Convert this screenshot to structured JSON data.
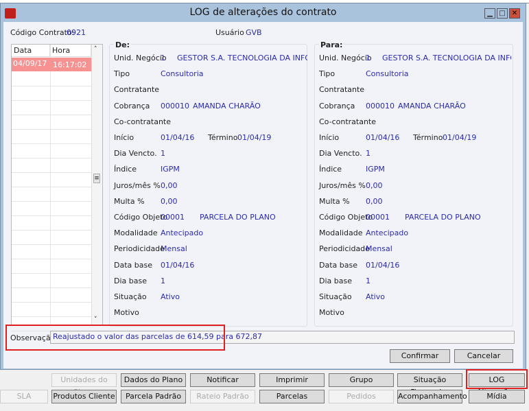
{
  "window": {
    "title": "LOG de alterações do contrato",
    "minimize": "▁",
    "maximize": "□",
    "close": "✕"
  },
  "header": {
    "contract_label": "Código Contrato:",
    "contract_value": "0921",
    "user_label": "Usuário",
    "user_value": "GVB"
  },
  "log_grid": {
    "columns": [
      "Data",
      "Hora"
    ],
    "rows": [
      {
        "data": "04/09/17",
        "hora": "16:17:02"
      }
    ]
  },
  "de": {
    "title": "De:",
    "unid_label": "Unid. Negócio",
    "unid_code": "1",
    "unid_name": "GESTOR S.A. TECNOLOGIA DA INFORMACA",
    "tipo_label": "Tipo",
    "tipo": "Consultoria",
    "contratante_label": "Contratante",
    "cobranca_label": "Cobrança",
    "cobranca_code": "000010",
    "cobranca_name": "AMANDA CHARÃO",
    "cocontratante_label": "Co-contratante",
    "inicio_label": "Início",
    "inicio": "01/04/16",
    "termino_label": "Término",
    "termino": "01/04/19",
    "venc_label": "Dia Vencto.",
    "venc": "1",
    "indice_label": "Índice",
    "indice": "IGPM",
    "juros_label": "Juros/mês %",
    "juros": "0,00",
    "multa_label": "Multa %",
    "multa": "0,00",
    "objeto_label": "Código Objeto",
    "objeto_code": "00001",
    "objeto_name": "PARCELA DO PLANO",
    "modalidade_label": "Modalidade",
    "modalidade": "Antecipado",
    "periodicidade_label": "Periodicidade",
    "periodicidade": "Mensal",
    "database_label": "Data base",
    "database": "01/04/16",
    "diabase_label": "Dia base",
    "diabase": "1",
    "situacao_label": "Situação",
    "situacao": "Ativo",
    "motivo_label": "Motivo"
  },
  "para": {
    "title": "Para:",
    "unid_label": "Unid. Negócio",
    "unid_code": "1",
    "unid_name": "GESTOR S.A. TECNOLOGIA DA INFORMACA",
    "tipo_label": "Tipo",
    "tipo": "Consultoria",
    "contratante_label": "Contratante",
    "cobranca_label": "Cobrança",
    "cobranca_code": "000010",
    "cobranca_name": "AMANDA CHARÃO",
    "cocontratante_label": "Co-contratante",
    "inicio_label": "Início",
    "inicio": "01/04/16",
    "termino_label": "Término",
    "termino": "01/04/19",
    "venc_label": "Dia Vencto.",
    "venc": "1",
    "indice_label": "Índice",
    "indice": "IGPM",
    "juros_label": "Juros/mês %",
    "juros": "0,00",
    "multa_label": "Multa %",
    "multa": "0,00",
    "objeto_label": "Código Objeto",
    "objeto_code": "00001",
    "objeto_name": "PARCELA DO PLANO",
    "modalidade_label": "Modalidade",
    "modalidade": "Antecipado",
    "periodicidade_label": "Periodicidade",
    "periodicidade": "Mensal",
    "database_label": "Data base",
    "database": "01/04/16",
    "diabase_label": "Dia base",
    "diabase": "1",
    "situacao_label": "Situação",
    "situacao": "Ativo",
    "motivo_label": "Motivo"
  },
  "observacao": {
    "label": "Observação",
    "value": "Reajustado o valor das parcelas de 614,59 para 672,87"
  },
  "dialog_buttons": {
    "confirm": "Confirmar",
    "cancel": "Cancelar"
  },
  "toolbar": {
    "row1": [
      "Unidades do Plano",
      "Dados do Plano",
      "Notificar",
      "Imprimir",
      "Grupo",
      "Situação Financeira",
      "LOG Alterações"
    ],
    "row2": [
      "SLA",
      "Produtos Cliente",
      "Parcela Padrão",
      "Rateio Padrão",
      "Parcelas",
      "Pedidos",
      "Acompanhamento",
      "Mídia"
    ],
    "disabled": [
      "Unidades do Plano",
      "SLA",
      "Rateio Padrão",
      "Pedidos"
    ]
  },
  "highlight_color": "#e02020"
}
